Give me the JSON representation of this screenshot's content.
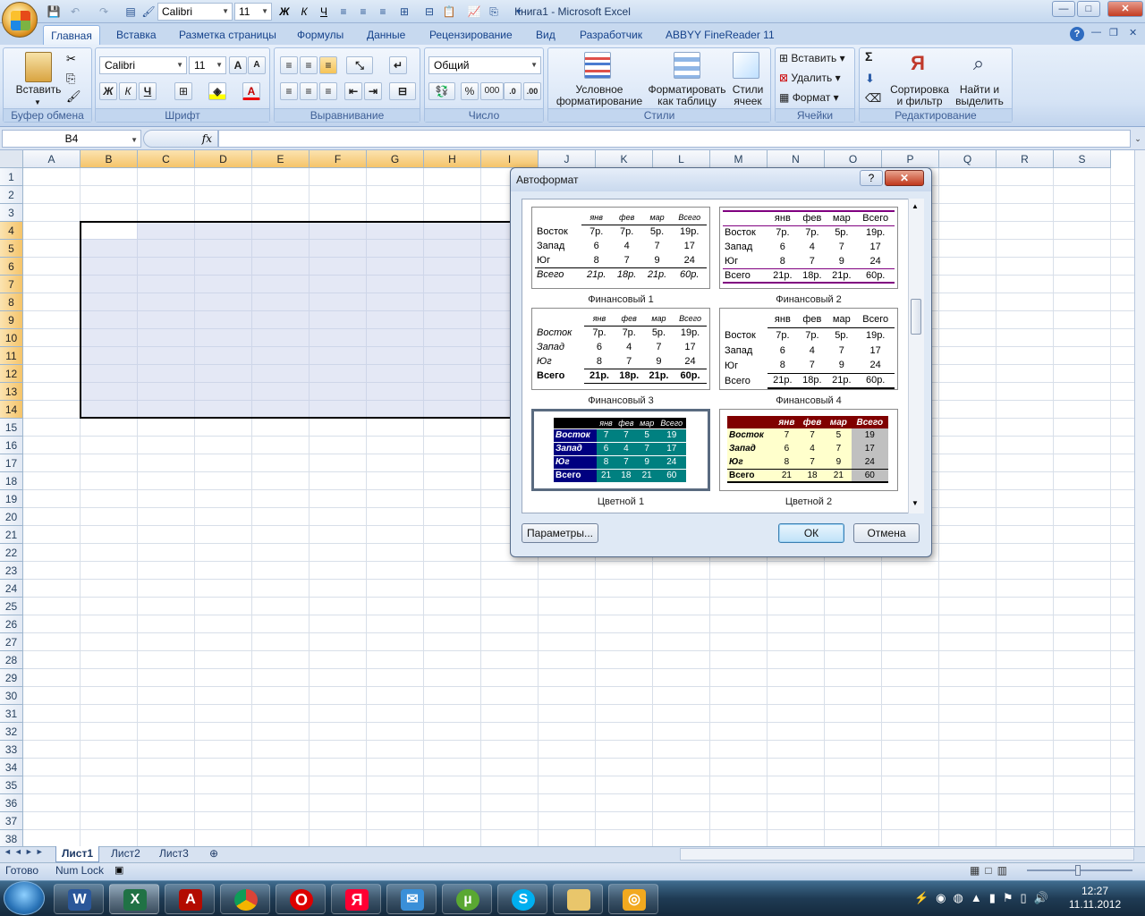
{
  "window": {
    "title": "Книга1 - Microsoft Excel",
    "min": "—",
    "max": "□",
    "close": "✕"
  },
  "qat": {
    "font": "Calibri",
    "size": "11",
    "bold": "Ж",
    "italic": "К",
    "underline": "Ч"
  },
  "tabs": [
    "Главная",
    "Вставка",
    "Разметка страницы",
    "Формулы",
    "Данные",
    "Рецензирование",
    "Вид",
    "Разработчик",
    "ABBYY FineReader 11"
  ],
  "ribbon": {
    "clipboard": {
      "paste": "Вставить",
      "label": "Буфер обмена"
    },
    "font": {
      "name": "Calibri",
      "size": "11",
      "label": "Шрифт",
      "bold": "Ж",
      "italic": "К",
      "underline": "Ч",
      "grow": "A",
      "shrink": "A"
    },
    "alignment": {
      "label": "Выравнивание"
    },
    "number": {
      "format": "Общий",
      "label": "Число",
      "percent": "%",
      "thousands": "000"
    },
    "styles": {
      "conditional": "Условное\nформатирование",
      "table": "Форматировать\nкак таблицу",
      "cellstyles": "Стили\nячеек",
      "label": "Стили"
    },
    "cells": {
      "insert": "Вставить",
      "delete": "Удалить",
      "format": "Формат",
      "label": "Ячейки"
    },
    "editing": {
      "sum": "Σ",
      "sort": "Сортировка\nи фильтр",
      "find": "Найти и\nвыделить",
      "label": "Редактирование"
    }
  },
  "formula_bar": {
    "name_box": "B4",
    "fx": "fx",
    "value": ""
  },
  "columns": [
    "A",
    "B",
    "C",
    "D",
    "E",
    "F",
    "G",
    "H",
    "I",
    "J",
    "K",
    "L",
    "M",
    "N",
    "O",
    "P",
    "Q",
    "R",
    "S"
  ],
  "rows": [
    "1",
    "2",
    "3",
    "4",
    "5",
    "6",
    "7",
    "8",
    "9",
    "10",
    "11",
    "12",
    "13",
    "14",
    "15",
    "16",
    "17",
    "18",
    "19",
    "20",
    "21",
    "22",
    "23",
    "24",
    "25",
    "26",
    "27",
    "28",
    "29",
    "30",
    "31",
    "32",
    "33",
    "34",
    "35",
    "36",
    "37",
    "38"
  ],
  "sheets": [
    "Лист1",
    "Лист2",
    "Лист3"
  ],
  "status": {
    "ready": "Готово",
    "numlock": "Num Lock"
  },
  "clock": {
    "time": "12:27",
    "date": "11.11.2012"
  },
  "dialog": {
    "title": "Автоформат",
    "help": "?",
    "close": "✕",
    "formats": [
      {
        "name": "Финансовый 1"
      },
      {
        "name": "Финансовый 2"
      },
      {
        "name": "Финансовый 3"
      },
      {
        "name": "Финансовый 4"
      },
      {
        "name": "Цветной 1"
      },
      {
        "name": "Цветной 2"
      }
    ],
    "sample": {
      "months": [
        "янв",
        "фев",
        "мар",
        "Всего"
      ],
      "regions": [
        "Восток",
        "Запад",
        "Юг",
        "Всего"
      ],
      "money": [
        [
          "7р.",
          "7р.",
          "5р.",
          "19р."
        ],
        [
          "6",
          "4",
          "7",
          "17"
        ],
        [
          "8",
          "7",
          "9",
          "24"
        ],
        [
          "21р.",
          "18р.",
          "21р.",
          "60р."
        ]
      ],
      "plain": [
        [
          "7",
          "7",
          "5",
          "19"
        ],
        [
          "6",
          "4",
          "7",
          "17"
        ],
        [
          "8",
          "7",
          "9",
          "24"
        ],
        [
          "21",
          "18",
          "21",
          "60"
        ]
      ]
    },
    "params_button": "Параметры...",
    "ok_button": "ОК",
    "cancel_button": "Отмена"
  }
}
